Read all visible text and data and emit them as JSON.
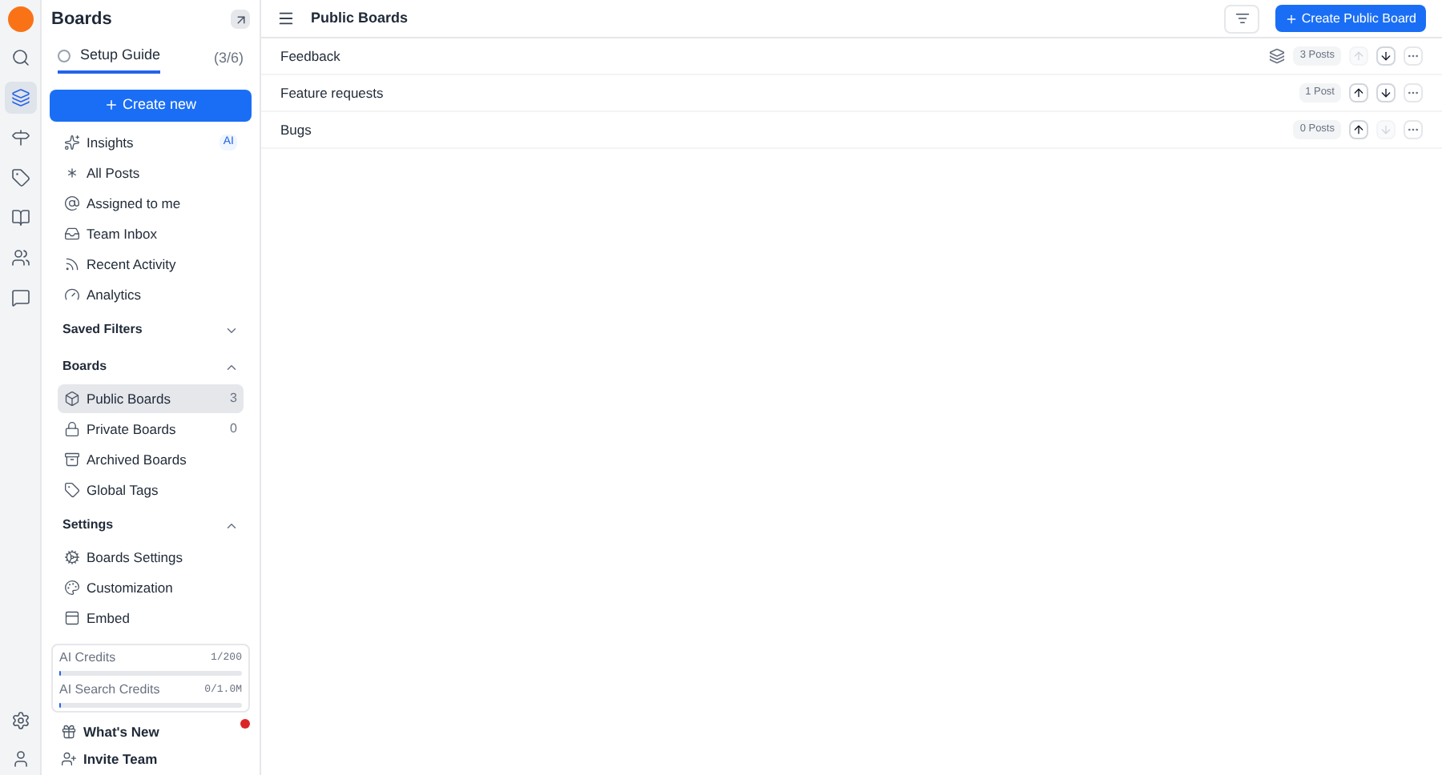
{
  "rail": {
    "items": [
      {
        "kind": "search",
        "selected": false
      },
      {
        "kind": "layers",
        "selected": true
      },
      {
        "kind": "signpost",
        "selected": false
      },
      {
        "kind": "tag",
        "selected": false
      },
      {
        "kind": "book",
        "selected": false
      },
      {
        "kind": "users",
        "selected": false
      },
      {
        "kind": "message",
        "selected": false
      }
    ]
  },
  "sidebar": {
    "title": "Boards",
    "setup_guide": {
      "label": "Setup Guide",
      "checked": false,
      "progress": "(3/6)"
    },
    "create_button": "Create new",
    "items": [
      {
        "kind": "sparkles",
        "label": "Insights",
        "badge": "AI"
      },
      {
        "kind": "asterisk",
        "label": "All Posts"
      },
      {
        "kind": "at",
        "label": "Assigned to me"
      },
      {
        "kind": "inbox",
        "label": "Team Inbox"
      },
      {
        "kind": "rss",
        "label": "Recent Activity"
      },
      {
        "kind": "gauge",
        "label": "Analytics"
      }
    ],
    "sections": [
      {
        "title": "Saved Filters",
        "expanded": false
      },
      {
        "title": "Boards",
        "expanded": true,
        "items": [
          {
            "kind": "box",
            "label": "Public Boards",
            "count": "3",
            "selected": true
          },
          {
            "kind": "lock",
            "label": "Private Boards",
            "count": "0",
            "selected": false
          },
          {
            "kind": "archive",
            "label": "Archived Boards",
            "selected": false
          },
          {
            "kind": "tag",
            "label": "Global Tags",
            "selected": false
          }
        ]
      },
      {
        "title": "Settings",
        "expanded": true,
        "items": [
          {
            "kind": "cog",
            "label": "Boards Settings",
            "selected": false
          },
          {
            "kind": "palette",
            "label": "Customization",
            "selected": false
          },
          {
            "kind": "panel",
            "label": "Embed",
            "selected": false
          }
        ]
      }
    ],
    "credits": [
      {
        "label": "AI Credits",
        "reading": "1/200",
        "level": 0.005
      },
      {
        "label": "AI Search Credits",
        "reading": "0/1.0M",
        "level": 0
      }
    ],
    "footer": [
      {
        "kind": "gift",
        "label": "What's New",
        "notification": true
      },
      {
        "kind": "user-plus",
        "label": "Invite Team",
        "notification": false
      }
    ]
  },
  "header": {
    "title": "Public Boards",
    "create_button": "Create Public Board"
  },
  "boards": [
    {
      "name": "Feedback",
      "posts": "3 Posts",
      "default": true,
      "up_disabled": true,
      "down_disabled": false
    },
    {
      "name": "Feature requests",
      "posts": "1 Post",
      "default": false,
      "up_disabled": false,
      "down_disabled": false
    },
    {
      "name": "Bugs",
      "posts": "0 Posts",
      "default": false,
      "up_disabled": false,
      "down_disabled": true
    }
  ]
}
